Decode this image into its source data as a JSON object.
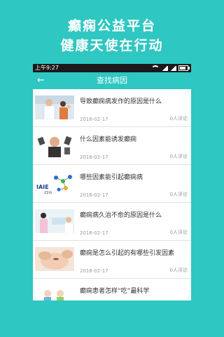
{
  "promo": {
    "line1": "癫痫公益平台",
    "line2": "健康天使在行动"
  },
  "statusbar": {
    "time": "上午9:27"
  },
  "header": {
    "back_icon": "←",
    "title": "查找病因"
  },
  "articles": [
    {
      "title": "导致癫痫病发作的原因是什么",
      "date": "2016-02-17",
      "comments": "0人评论",
      "thumb": "doctor-patient"
    },
    {
      "title": "什么因素能诱发癫痫",
      "date": "2016-02-17",
      "comments": "0人评论",
      "thumb": "man-with-bottles"
    },
    {
      "title": "哪些因素能引起癫痫病",
      "date": "2016-02-17",
      "comments": "0人评论",
      "thumb": "molecule-logo",
      "thumb_text": "IAIE",
      "thumb_subtext": "21th"
    },
    {
      "title": "癫痫病久治不愈的原因是什么",
      "date": "2016-02-17",
      "comments": "0人评论",
      "thumb": "nurses"
    },
    {
      "title": "癫痫是怎么引起的有哪些引发因素",
      "date": "2016-02-17",
      "comments": "0人评论",
      "thumb": "woman-face"
    },
    {
      "title": "癫痫患者怎样“吃”最科学",
      "date": "",
      "comments": "",
      "thumb": "cartoon-figures"
    }
  ],
  "colors": {
    "accent": "#2ec7c2",
    "statusbar": "#1a1a1a"
  }
}
